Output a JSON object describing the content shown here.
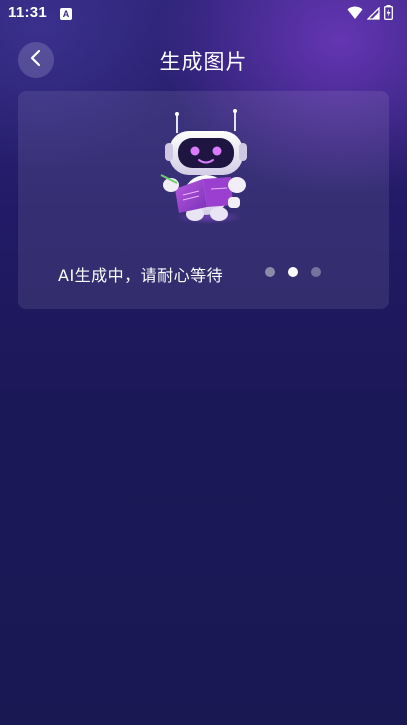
{
  "status_bar": {
    "time": "11:31",
    "notification_badge": "A",
    "icons": [
      "wifi-icon",
      "signal-icon",
      "battery-icon"
    ]
  },
  "header": {
    "title": "生成图片",
    "back_icon": "chevron-left-icon"
  },
  "card": {
    "illustration": "robot-reading-book",
    "status_text": "AI生成中，请耐心等待",
    "loading_dots": {
      "count": 3,
      "active_index": 1
    }
  },
  "colors": {
    "background_top": "#2e2478",
    "background_bottom": "#1a1853",
    "accent_purple": "#9b4fd6",
    "dot_active": "#ffffff",
    "dot_inactive": "#8e8aa8"
  }
}
